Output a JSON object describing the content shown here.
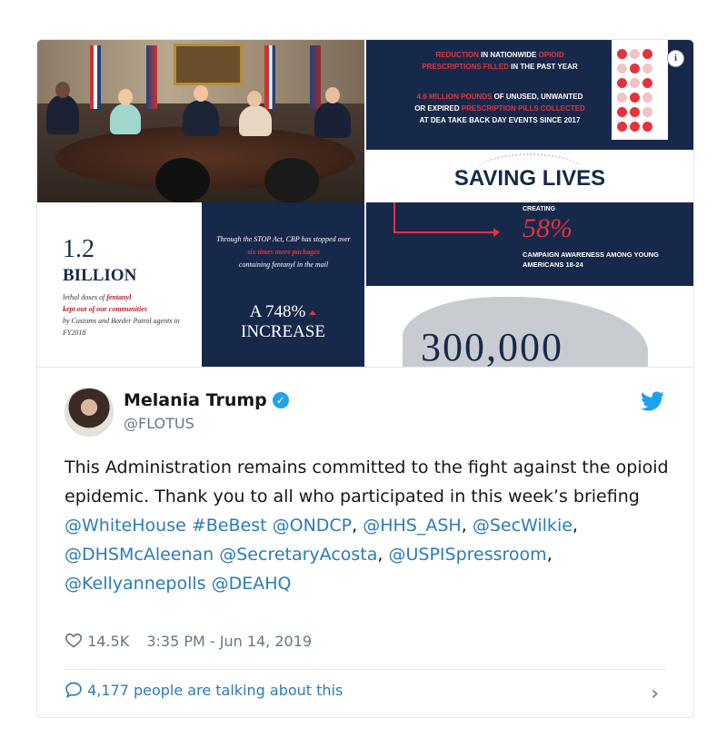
{
  "media": {
    "top_right": {
      "line1_red": "REDUCTION",
      "line1_rest": "IN NATIONWIDE",
      "line1_red2": "OPIOID",
      "line2_red": "PRESCRIPTIONS FILLED",
      "line2_rest": "IN THE PAST YEAR",
      "line3_red": "4.6 MILLION POUNDS",
      "line3_rest": "OF UNUSED, UNWANTED",
      "line4_rest": "OR EXPIRED",
      "line4_red": "PRESCRIPTION PILLS COLLECTED",
      "line5": "AT DEA TAKE BACK DAY EVENTS SINCE 2017"
    },
    "saving_title": "SAVING LIVES",
    "creating_label": "CREATING",
    "creating_pct": "58%",
    "creating_desc": "CAMPAIGN AWARENESS AMONG YOUNG AMERICANS 18-24",
    "map_number": "300,000",
    "billion_num": "1.2",
    "billion_word": "BILLION",
    "billion_desc1": "lethal doses of",
    "billion_desc_em1": "fentanyl",
    "billion_desc_em2": "kept out of our communities",
    "billion_desc2": "by Customs and Border Patrol agents in FY2018",
    "stop_text1": "Through the STOP Act, CBP has stopped over",
    "stop_text_red": "six times more packages",
    "stop_text2": "containing fentanyl in the mail",
    "stop_big1": "A 748%",
    "stop_big2": "INCREASE"
  },
  "tweet": {
    "name": "Melania Trump",
    "handle": "@FLOTUS",
    "text_plain": "This Administration remains committed to the fight against the opioid epidemic. Thank you to all who participated in this week’s briefing ",
    "mentions": {
      "m1": "@WhiteHouse",
      "m2": "#BeBest",
      "m3": "@ONDCP",
      "m4": "@HHS_ASH",
      "m5": "@SecWilkie",
      "m6": "@DHSMcAleenan",
      "m7": "@SecretaryAcosta",
      "m8": "@USPISpressroom",
      "m9": "@Kellyannepolls",
      "m10": "@DEAHQ"
    },
    "likes": "14.5K",
    "timestamp": "3:35 PM - Jun 14, 2019",
    "talking": "4,177 people are talking about this"
  },
  "icons": {
    "verified": "verified-badge-icon",
    "twitter": "twitter-bird-icon",
    "like": "heart-icon",
    "reply": "speech-bubble-icon",
    "info": "info-icon",
    "chevron": "chevron-right-icon"
  },
  "colors": {
    "link": "#2b7bb9",
    "navy": "#17294a",
    "accent_red": "#e3343c",
    "twitter_blue": "#1da1f2",
    "muted": "#657786"
  }
}
